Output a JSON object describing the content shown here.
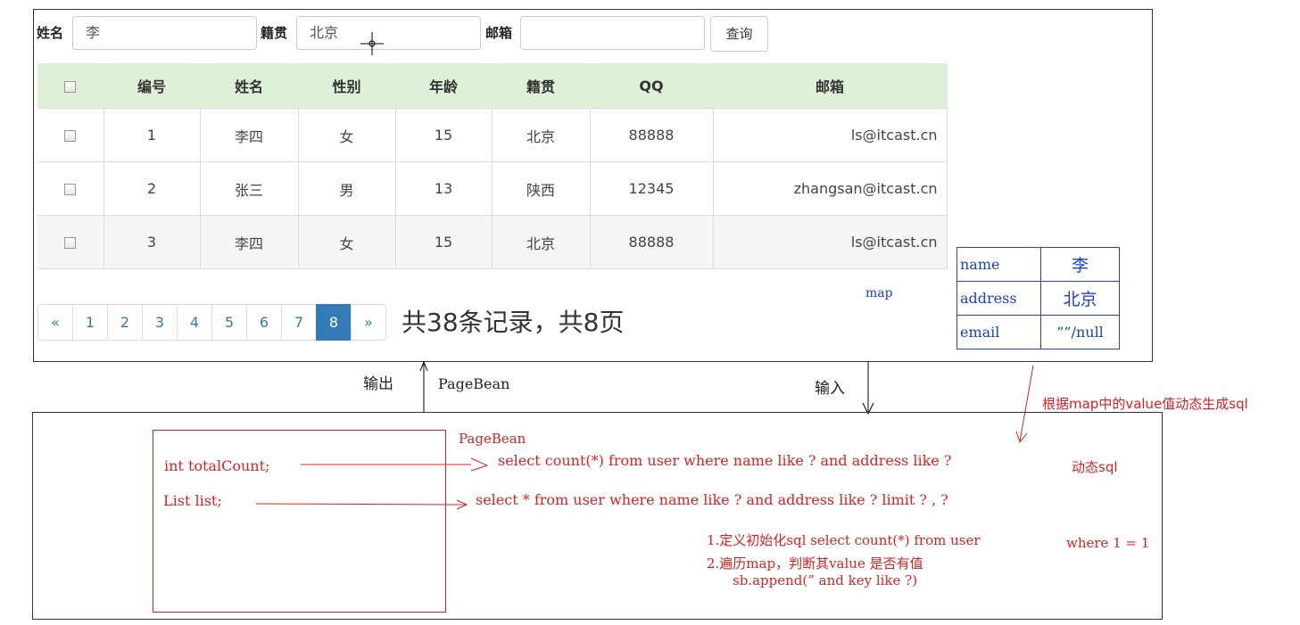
{
  "search": {
    "name_label": "姓名",
    "name_value": "李",
    "address_label": "籍贯",
    "address_value": "北京",
    "email_label": "邮箱",
    "email_value": "",
    "query_button": "查询"
  },
  "table": {
    "headers": [
      "编号",
      "姓名",
      "性别",
      "年龄",
      "籍贯",
      "QQ",
      "邮箱"
    ],
    "rows": [
      {
        "id": "1",
        "name": "李四",
        "gender": "女",
        "age": "15",
        "address": "北京",
        "qq": "88888",
        "email": "ls@itcast.cn"
      },
      {
        "id": "2",
        "name": "张三",
        "gender": "男",
        "age": "13",
        "address": "陕西",
        "qq": "12345",
        "email": "zhangsan@itcast.cn"
      },
      {
        "id": "3",
        "name": "李四",
        "gender": "女",
        "age": "15",
        "address": "北京",
        "qq": "88888",
        "email": "ls@itcast.cn"
      }
    ]
  },
  "pagination": {
    "prev": "«",
    "pages": [
      "1",
      "2",
      "3",
      "4",
      "5",
      "6",
      "7",
      "8"
    ],
    "active_page": "8",
    "next": "»",
    "summary": "共38条记录，共8页"
  },
  "annotations": {
    "map_label": "map",
    "map_rows": [
      {
        "key": "name",
        "value": "李"
      },
      {
        "key": "address",
        "value": "北京"
      },
      {
        "key": "email",
        "value": "””/null"
      }
    ],
    "output_label": "输出",
    "pagebean_arrow_label": "PageBean",
    "input_label": "输入",
    "map_note": "根据map中的value值动态生成sql",
    "pagebean_title": "PageBean",
    "field_total": "int totalCount;",
    "field_list": "List list;",
    "sql_count": "select count(*) from user where name like ? and address like ?",
    "sql_list": "select * from user where name like ? and address like ? limit ? , ?",
    "dynamic_sql": "动态sql",
    "step1": "1.定义初始化sql select count(*) from user",
    "step1_where": "where 1 = 1",
    "step2": "2.遍历map，判断其value 是否有值",
    "step3": "sb.append(” and  key like ?)"
  },
  "colors": {
    "header_bg": "#dff0d8",
    "active_page": "#337ab7",
    "annotation_red": "#e02020",
    "annotation_blue": "#1a3fd0"
  }
}
